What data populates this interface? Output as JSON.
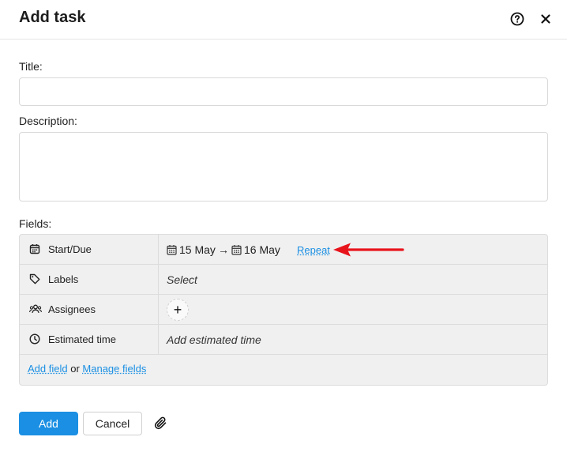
{
  "dialog": {
    "title": "Add task",
    "help_icon": "help-circle-icon",
    "close_icon": "close-icon"
  },
  "form": {
    "title_label": "Title:",
    "title_value": "",
    "description_label": "Description:",
    "description_value": "",
    "fields_label": "Fields:"
  },
  "fields": {
    "rows": [
      {
        "name": "Start/Due",
        "icon": "calendar-icon"
      },
      {
        "name": "Labels",
        "icon": "tag-icon",
        "value": "Select"
      },
      {
        "name": "Assignees",
        "icon": "people-icon",
        "value": "+"
      },
      {
        "name": "Estimated time",
        "icon": "clock-icon",
        "value": "Add estimated time"
      }
    ],
    "start_date": "15 May",
    "arrow_glyph": "→",
    "due_date": "16 May",
    "repeat_label": "Repeat",
    "add_field_label": "Add field",
    "or_text": "or",
    "manage_fields_label": "Manage fields"
  },
  "footer": {
    "add_label": "Add",
    "cancel_label": "Cancel",
    "attach_icon": "paperclip-icon"
  },
  "colors": {
    "accent": "#1a8fe3",
    "annotation_arrow": "#e8141c"
  }
}
